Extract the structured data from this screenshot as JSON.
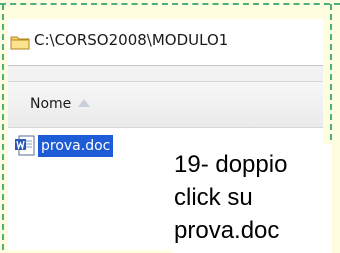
{
  "explorer": {
    "address_path": "C:\\CORSO2008\\MODULO1",
    "column_header": "Nome",
    "file_name": "prova.doc"
  },
  "caption": {
    "lines": [
      "19- doppio",
      "click su",
      "prova.doc"
    ]
  },
  "colors": {
    "selection": "#1e5bd6",
    "frame_dash": "#4caf7c",
    "slide_background": "#fefde0"
  },
  "icons": {
    "folder": "folder-icon",
    "sort": "sort-ascending-icon",
    "document": "word-document-icon"
  }
}
